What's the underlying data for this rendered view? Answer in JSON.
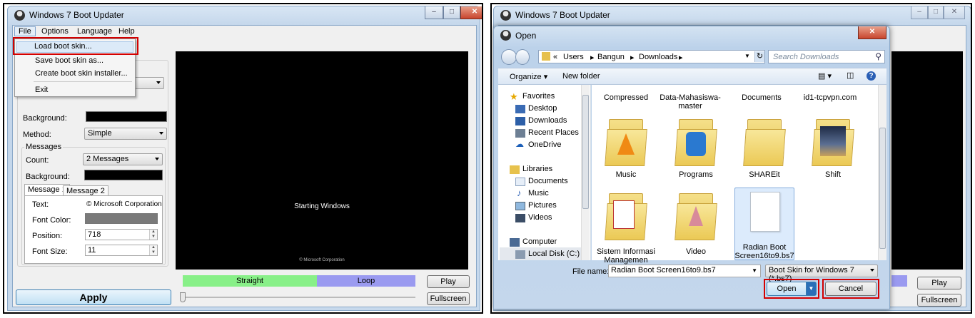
{
  "left_window": {
    "title": "Windows 7 Boot Updater",
    "menu": [
      "File",
      "Options",
      "Language",
      "Help"
    ],
    "file_menu": [
      "Load boot skin...",
      "Save boot skin as...",
      "Create boot skin installer...",
      "Exit"
    ],
    "background_label": "Background:",
    "method_label": "Method:",
    "method_value": "Simple",
    "messages_group": "Messages",
    "count_label": "Count:",
    "count_value": "2 Messages",
    "msg_background_label": "Background:",
    "tabs": [
      "Message 1",
      "Message 2"
    ],
    "text_label": "Text:",
    "text_value": "© Microsoft Corporation",
    "font_color_label": "Font Color:",
    "position_label": "Position:",
    "position_value": "718",
    "font_size_label": "Font Size:",
    "font_size_value": "11",
    "preview_text": "Starting Windows",
    "preview_copyright": "© Microsoft Corporation",
    "straight_label": "Straight",
    "loop_label": "Loop",
    "play_label": "Play",
    "apply_label": "Apply",
    "fullscreen_label": "Fullscreen",
    "colors": {
      "straight": "#88f088",
      "loop": "#9a9af0",
      "highlight_border": "#d40000"
    }
  },
  "right_window": {
    "title": "Windows 7 Boot Updater",
    "play_label": "Play",
    "fullscreen_label": "Fullscreen"
  },
  "open_dialog": {
    "title": "Open",
    "breadcrumb": [
      "«",
      "Users",
      "Bangun",
      "Downloads"
    ],
    "search_placeholder": "Search Downloads",
    "organize_label": "Organize ▾",
    "new_folder_label": "New folder",
    "nav": {
      "favorites": "Favorites",
      "desktop": "Desktop",
      "downloads": "Downloads",
      "recent_places": "Recent Places",
      "onedrive": "OneDrive",
      "libraries": "Libraries",
      "documents": "Documents",
      "music": "Music",
      "pictures": "Pictures",
      "videos": "Videos",
      "computer": "Computer",
      "local_disk": "Local Disk (C:)"
    },
    "top_row": [
      "Compressed",
      "Data-Mahasiswa-master",
      "Documents",
      "id1-tcpvpn.com"
    ],
    "folders": [
      {
        "name": "Music"
      },
      {
        "name": "Programs"
      },
      {
        "name": "SHAREit"
      },
      {
        "name": "Shift"
      },
      {
        "name": "Sistem Informasi Managemen"
      },
      {
        "name": "Video"
      },
      {
        "name": "Radian Boot Screen16to9.bs7"
      }
    ],
    "file_name_label": "File name:",
    "file_name_value": "Radian Boot Screen16to9.bs7",
    "filter_value": "Boot Skin for Windows 7 (*.bs7)",
    "open_label": "Open",
    "cancel_label": "Cancel"
  }
}
